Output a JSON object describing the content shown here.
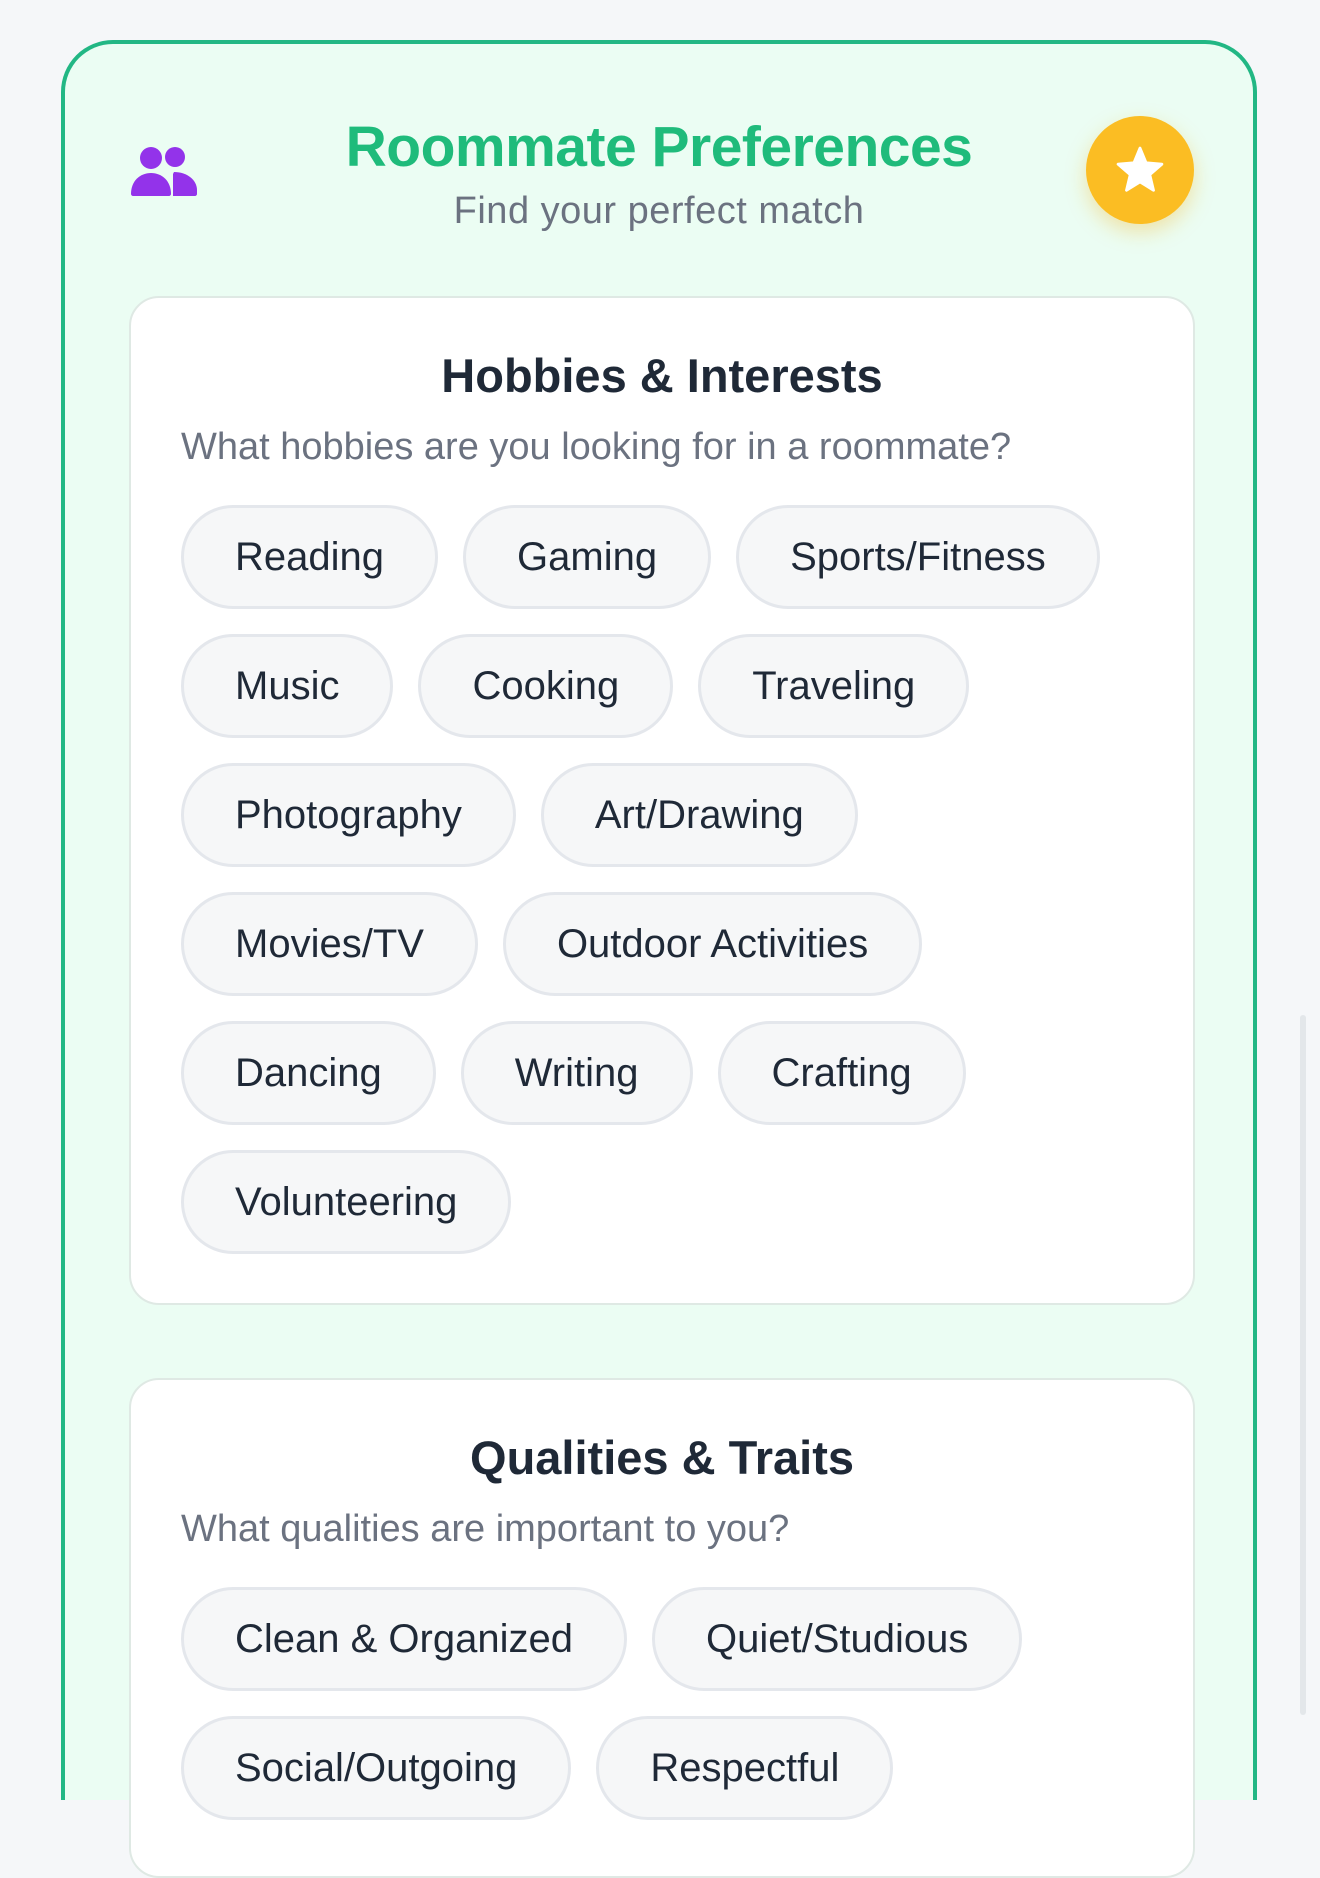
{
  "header": {
    "title": "Roommate Preferences",
    "subtitle": "Find your perfect match",
    "left_icon": "users-icon",
    "right_icon": "star-icon"
  },
  "hobbies": {
    "title": "Hobbies & Interests",
    "description": "What hobbies are you looking for in a roommate?",
    "options": [
      "Reading",
      "Gaming",
      "Sports/Fitness",
      "Music",
      "Cooking",
      "Traveling",
      "Photography",
      "Art/Drawing",
      "Movies/TV",
      "Outdoor Activities",
      "Dancing",
      "Writing",
      "Crafting",
      "Volunteering"
    ]
  },
  "qualities": {
    "title": "Qualities & Traits",
    "description": "What qualities are important to you?",
    "options": [
      "Clean & Organized",
      "Quiet/Studious",
      "Social/Outgoing",
      "Respectful"
    ]
  },
  "colors": {
    "accent": "#1fbb7b",
    "frame_border": "#22b784",
    "frame_background": "#ebfdf3",
    "icon_purple": "#9333ea",
    "star_button": "#fbbd23"
  }
}
